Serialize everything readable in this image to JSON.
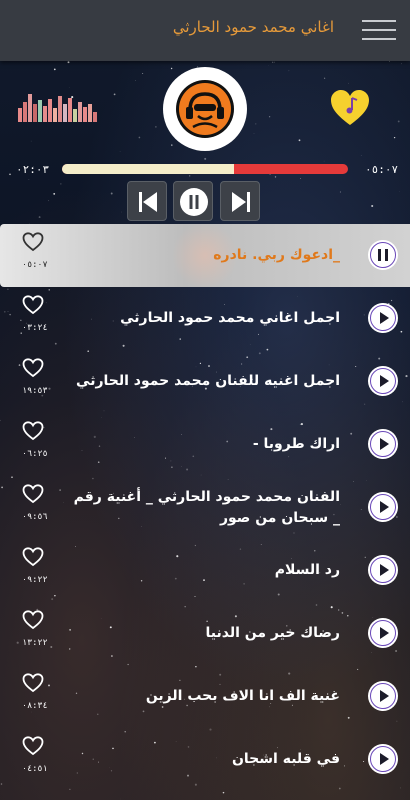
{
  "header": {
    "title": "اغاني محمد حمود الحارثي",
    "menu_icon": "hamburger-menu-icon"
  },
  "player": {
    "elapsed": "٠٢:٠٣",
    "total": "٠٥:٠٧",
    "progress_fraction": 0.6,
    "controls": [
      "skip-previous-icon",
      "pause-icon",
      "skip-next-icon"
    ],
    "logo_icon": "headphones-listener-icon",
    "favorite_icon": "heart-music-note-icon",
    "equalizer_icon": "equalizer-bars-icon"
  },
  "songs": [
    {
      "title": "_ادعوك ربي. نادره",
      "duration": "٠٥:٠٧",
      "playing": true
    },
    {
      "title": "اجمل اغاني محمد حمود الحارثي",
      "duration": "٠٣:٢٤",
      "playing": false
    },
    {
      "title": "اجمل اغنيه للفنان محمد حمود الحارثي",
      "duration": "١٩:٥٣",
      "playing": false
    },
    {
      "title": "اراك طروبا -",
      "duration": "٠٦:٢٥",
      "playing": false
    },
    {
      "title": "الفنان محمد حمود الحارثي _ أغنية رقم _ سبحان من صور",
      "duration": "٠٩:٥٦",
      "playing": false
    },
    {
      "title": "رد السلام",
      "duration": "٠٩:٢٢",
      "playing": false
    },
    {
      "title": "رضاك خير من الدنيا",
      "duration": "١٣:٢٢",
      "playing": false
    },
    {
      "title": "غنية الف انا الاف بحب الزين",
      "duration": "٠٨:٣٤",
      "playing": false
    },
    {
      "title": "في قلبه اشجان",
      "duration": "٠٤:٥١",
      "playing": false
    }
  ],
  "colors": {
    "accent_orange": "#e0791b",
    "progress_played": "#f4edc9",
    "progress_remaining": "#e53a3a",
    "header_bg": "#373b42",
    "heart_yellow": "#f6d12e"
  }
}
